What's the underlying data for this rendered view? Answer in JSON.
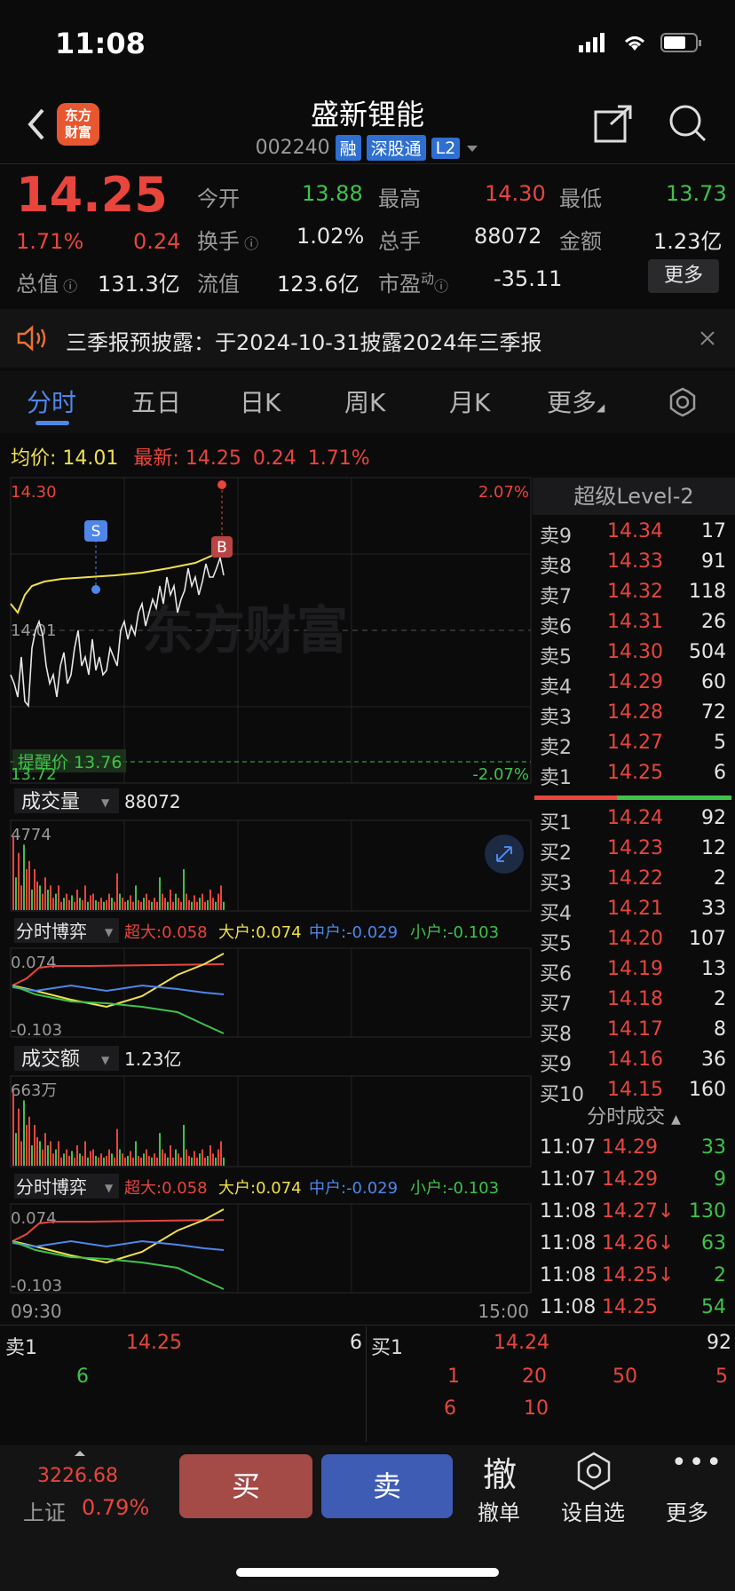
{
  "status": {
    "time": "11:08"
  },
  "header": {
    "title": "盛新锂能",
    "code": "002240",
    "tags": [
      "融",
      "深股通",
      "L2"
    ],
    "logo_text": "东方财富"
  },
  "quote": {
    "price": "14.25",
    "change_pct": "1.71%",
    "change": "0.24",
    "open_label": "今开",
    "open": "13.88",
    "high_label": "最高",
    "high": "14.30",
    "low_label": "最低",
    "low": "13.73",
    "turnover_label": "换手",
    "turnover": "1.02%",
    "volume_label": "总手",
    "volume": "88072",
    "amount_label": "金额",
    "amount": "1.23亿",
    "mcap_label": "总值",
    "mcap": "131.3亿",
    "float_label": "流值",
    "float": "123.6亿",
    "pe_label": "市盈",
    "pe_sup": "动",
    "pe": "-35.11",
    "more_button": "更多"
  },
  "banner": {
    "text": "三季报预披露：于2024-10-31披露2024年三季报"
  },
  "tabs": [
    "分时",
    "五日",
    "日K",
    "周K",
    "月K",
    "更多"
  ],
  "chart_info": {
    "avg_label": "均价:",
    "avg": "14.01",
    "latest_label": "最新:",
    "latest": "14.25",
    "latest_change": "0.24",
    "latest_pct": "1.71%",
    "y_top": "14.30",
    "y_mid": "14.01",
    "y_bot": "13.72",
    "pct_top": "2.07%",
    "pct_bot": "-2.07%",
    "alert_label": "提醒价 13.76",
    "time_start": "09:30",
    "time_end": "15:00",
    "watermark": "东方财富"
  },
  "panels": {
    "vol_label": "成交量",
    "vol_value": "88072",
    "vol_max": "4774",
    "game_label": "分时博弈",
    "game_super": "超大:0.058",
    "game_big": "大户:0.074",
    "game_mid": "中户:-0.029",
    "game_small": "小户:-0.103",
    "game_top": "0.074",
    "game_bot": "-0.103",
    "amt_label": "成交额",
    "amt_value": "1.23亿",
    "amt_max": "663万"
  },
  "orderbook": {
    "title": "超级Level-2",
    "asks": [
      {
        "label": "卖9",
        "price": "14.34",
        "vol": "17"
      },
      {
        "label": "卖8",
        "price": "14.33",
        "vol": "91"
      },
      {
        "label": "卖7",
        "price": "14.32",
        "vol": "118"
      },
      {
        "label": "卖6",
        "price": "14.31",
        "vol": "26"
      },
      {
        "label": "卖5",
        "price": "14.30",
        "vol": "504"
      },
      {
        "label": "卖4",
        "price": "14.29",
        "vol": "60"
      },
      {
        "label": "卖3",
        "price": "14.28",
        "vol": "72"
      },
      {
        "label": "卖2",
        "price": "14.27",
        "vol": "5"
      },
      {
        "label": "卖1",
        "price": "14.25",
        "vol": "6"
      }
    ],
    "bids": [
      {
        "label": "买1",
        "price": "14.24",
        "vol": "92"
      },
      {
        "label": "买2",
        "price": "14.23",
        "vol": "12"
      },
      {
        "label": "买3",
        "price": "14.22",
        "vol": "2"
      },
      {
        "label": "买4",
        "price": "14.21",
        "vol": "33"
      },
      {
        "label": "买5",
        "price": "14.20",
        "vol": "107"
      },
      {
        "label": "买6",
        "price": "14.19",
        "vol": "13"
      },
      {
        "label": "买7",
        "price": "14.18",
        "vol": "2"
      },
      {
        "label": "买8",
        "price": "14.17",
        "vol": "8"
      },
      {
        "label": "买9",
        "price": "14.16",
        "vol": "36"
      },
      {
        "label": "买10",
        "price": "14.15",
        "vol": "160"
      }
    ],
    "ticks_title": "分时成交",
    "ticks": [
      {
        "t": "11:07",
        "p": "14.29",
        "v": "33",
        "dir": ""
      },
      {
        "t": "11:07",
        "p": "14.29",
        "v": "9",
        "dir": ""
      },
      {
        "t": "11:08",
        "p": "14.27",
        "v": "130",
        "dir": "↓"
      },
      {
        "t": "11:08",
        "p": "14.26",
        "v": "63",
        "dir": "↓"
      },
      {
        "t": "11:08",
        "p": "14.25",
        "v": "2",
        "dir": "↓"
      },
      {
        "t": "11:08",
        "p": "14.25",
        "v": "54",
        "dir": ""
      }
    ]
  },
  "queue": {
    "sell_label": "卖1",
    "sell_price": "14.25",
    "sell_vol": "6",
    "sell_orders": [
      "6"
    ],
    "buy_label": "买1",
    "buy_price": "14.24",
    "buy_vol": "92",
    "buy_orders_row1": [
      "1",
      "20",
      "50",
      "5"
    ],
    "buy_orders_row2": [
      "6",
      "10"
    ]
  },
  "bottom": {
    "index_value": "3226.68",
    "index_name": "上证",
    "index_pct": "0.79%",
    "buy": "买",
    "sell": "卖",
    "cancel_icon": "撤",
    "cancel": "撤单",
    "watch": "设自选",
    "more": "更多"
  },
  "colors": {
    "up": "#e8453c",
    "down": "#3fc24a",
    "accent": "#4f86e8"
  }
}
